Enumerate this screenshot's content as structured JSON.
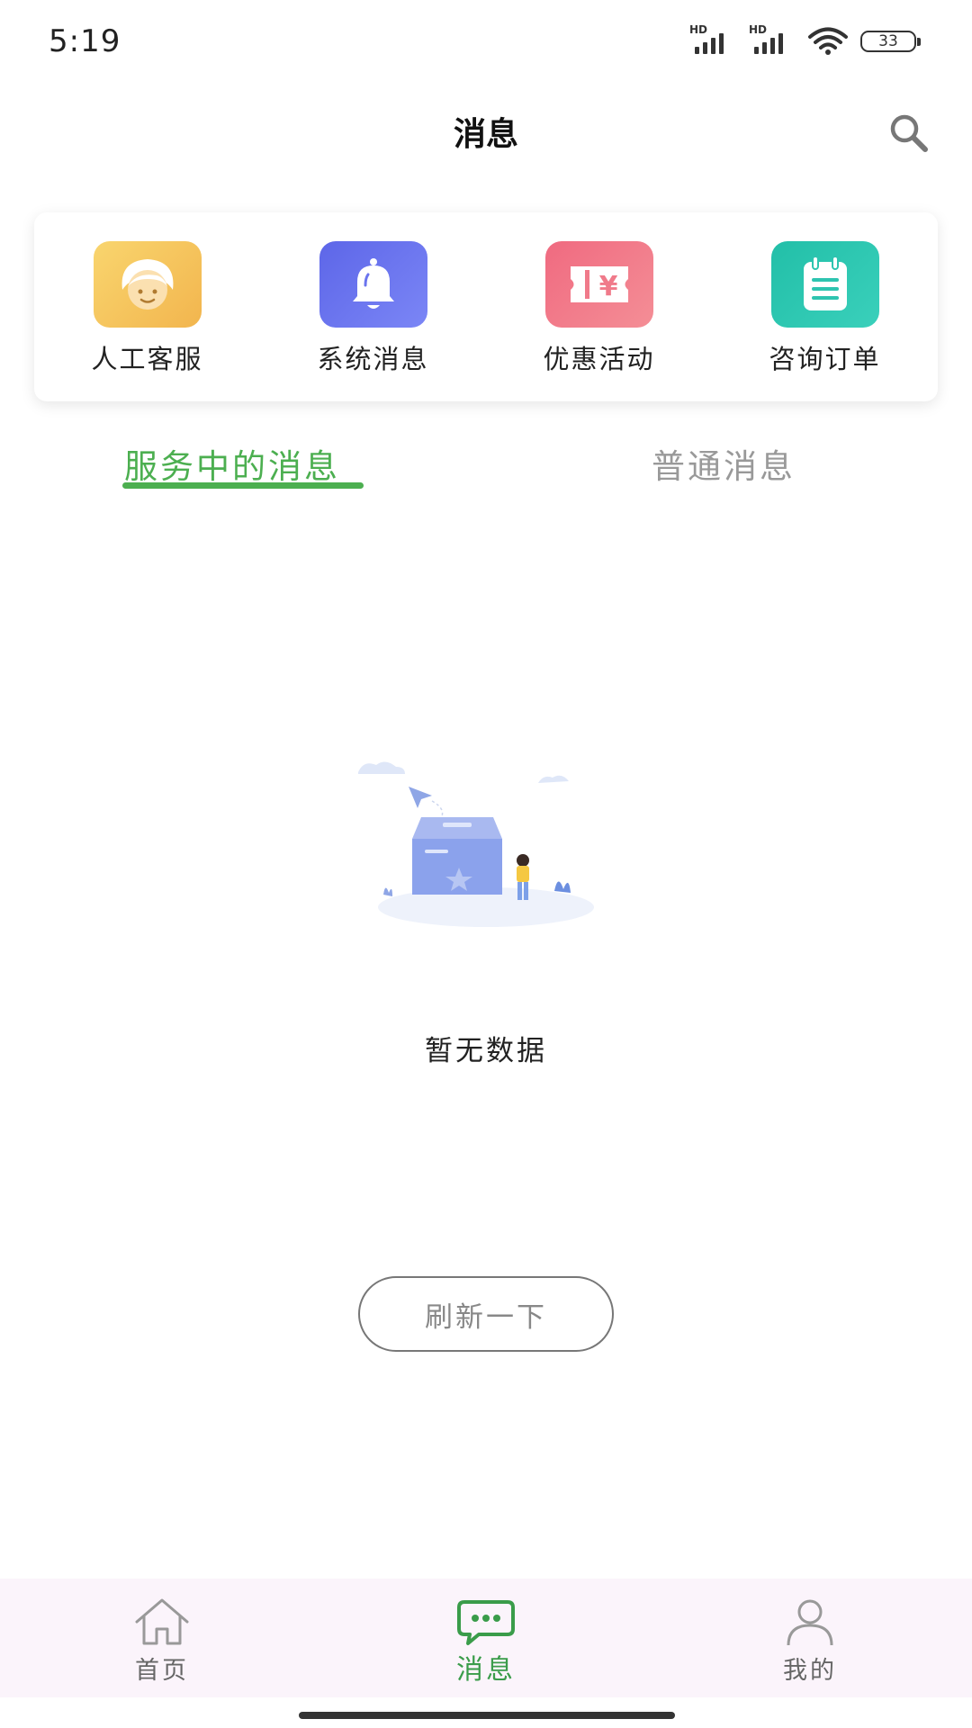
{
  "status_bar": {
    "time": "5:19",
    "signal1_label": "HD",
    "signal2_label": "HD",
    "battery": "33"
  },
  "header": {
    "title": "消息",
    "search_icon": "search-icon"
  },
  "shortcuts": [
    {
      "label": "人工客服",
      "icon": "customer-service-icon",
      "color": "#f6c558"
    },
    {
      "label": "系统消息",
      "icon": "bell-icon",
      "color": "#6a74ee"
    },
    {
      "label": "优惠活动",
      "icon": "coupon-icon",
      "color": "#f07a8a"
    },
    {
      "label": "咨询订单",
      "icon": "clipboard-icon",
      "color": "#2ec4b0"
    }
  ],
  "tabs": [
    {
      "label": "服务中的消息",
      "active": true
    },
    {
      "label": "普通消息",
      "active": false
    }
  ],
  "empty_state": {
    "text": "暂无数据",
    "refresh_label": "刷新一下"
  },
  "bottom_nav": [
    {
      "label": "首页",
      "icon": "home-icon",
      "active": false
    },
    {
      "label": "消息",
      "icon": "chat-bubble-icon",
      "active": true
    },
    {
      "label": "我的",
      "icon": "user-icon",
      "active": false
    }
  ],
  "colors": {
    "accent": "#4caf50",
    "nav_active": "#3a9c4a",
    "nav_bg": "#fbf4fb"
  }
}
